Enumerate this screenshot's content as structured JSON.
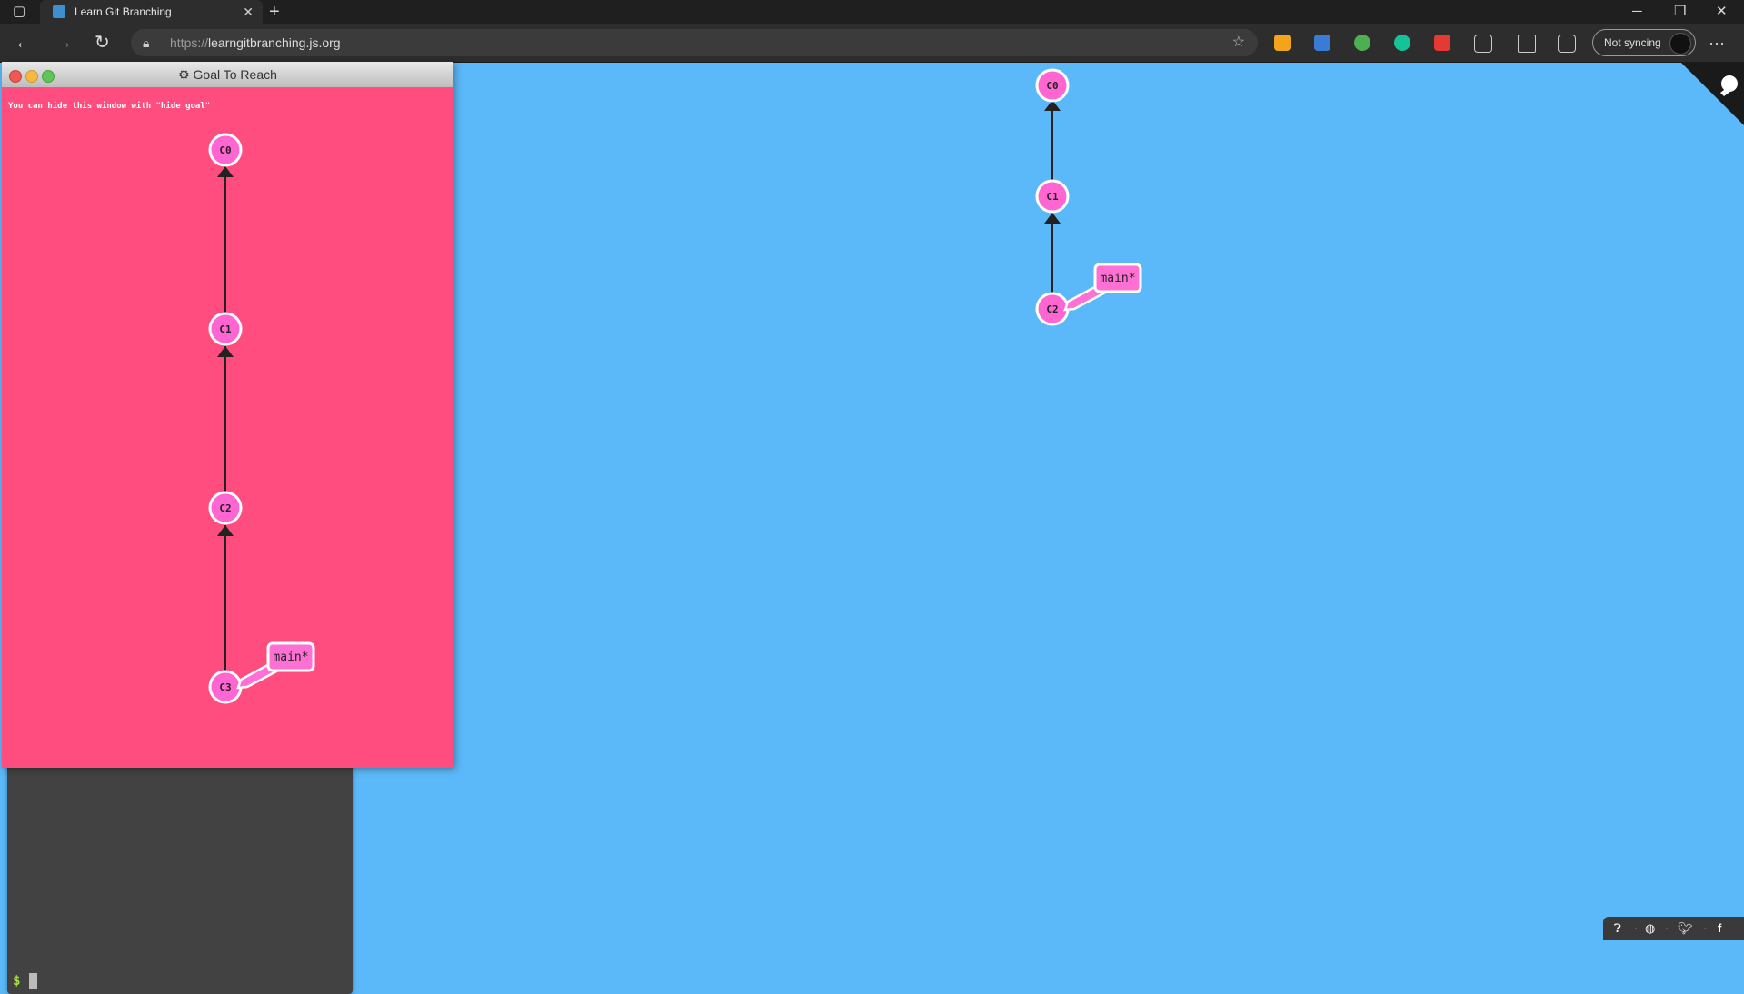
{
  "browser": {
    "tab_title": "Learn Git Branching",
    "tab_close": "✕",
    "new_tab": "+",
    "url_protocol": "https://",
    "url_domain": "learngitbranching.js.org",
    "sync_label": "Not syncing",
    "window_controls": {
      "minimize": "─",
      "restore": "❐",
      "close": "✕"
    },
    "more_label": "···"
  },
  "goal_window": {
    "title": "Goal To Reach",
    "hint": "You can hide this window with \"hide goal\"",
    "commits": [
      {
        "id": "C0"
      },
      {
        "id": "C1"
      },
      {
        "id": "C2"
      },
      {
        "id": "C3"
      }
    ],
    "branch": {
      "name": "main*",
      "target": "C3"
    }
  },
  "main_tree": {
    "commits": [
      {
        "id": "C0"
      },
      {
        "id": "C1"
      },
      {
        "id": "C2"
      }
    ],
    "branch": {
      "name": "main*",
      "target": "C2"
    }
  },
  "terminal": {
    "prompt": "$"
  },
  "colors": {
    "canvas_bg": "#5cb9f9",
    "goal_bg": "#ff4d80",
    "commit_fill": "#ff66d1",
    "branch_fill": "#ff70d4",
    "terminal_bg": "#424242"
  },
  "footer": {
    "icons": [
      "help-icon",
      "globe-icon",
      "twitter-icon",
      "facebook-icon"
    ]
  }
}
